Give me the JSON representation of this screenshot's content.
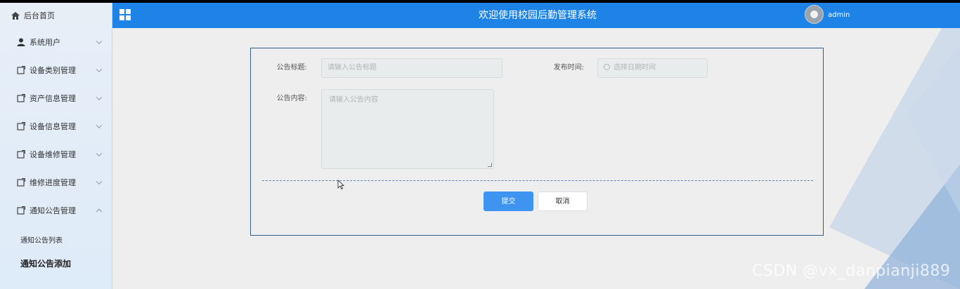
{
  "header": {
    "home_label": "后台首页",
    "title": "欢迎使用校园后勤管理系统",
    "username": "admin"
  },
  "sidebar": {
    "items": [
      {
        "label": "系统用户",
        "icon": "user-icon"
      },
      {
        "label": "设备类别管理",
        "icon": "edit-icon"
      },
      {
        "label": "资产信息管理",
        "icon": "edit-icon"
      },
      {
        "label": "设备信息管理",
        "icon": "edit-icon"
      },
      {
        "label": "设备维修管理",
        "icon": "edit-icon"
      },
      {
        "label": "维修进度管理",
        "icon": "edit-icon"
      },
      {
        "label": "通知公告管理",
        "icon": "edit-icon",
        "expanded": true
      }
    ],
    "subitems": [
      {
        "label": "通知公告列表",
        "active": false
      },
      {
        "label": "通知公告添加",
        "active": true
      }
    ]
  },
  "form": {
    "title_label": "公告标题:",
    "title_placeholder": "请输入公告标题",
    "time_label": "发布时间:",
    "time_placeholder": "选择日期时间",
    "content_label": "公告内容:",
    "content_placeholder": "请输入公告内容",
    "submit_label": "提交",
    "cancel_label": "取消"
  },
  "watermark": "CSDN @vx_danpianji889",
  "colors": {
    "header_bg": "#1d83e6",
    "primary_button": "#3e94f0",
    "panel_border": "#2f5d86"
  }
}
